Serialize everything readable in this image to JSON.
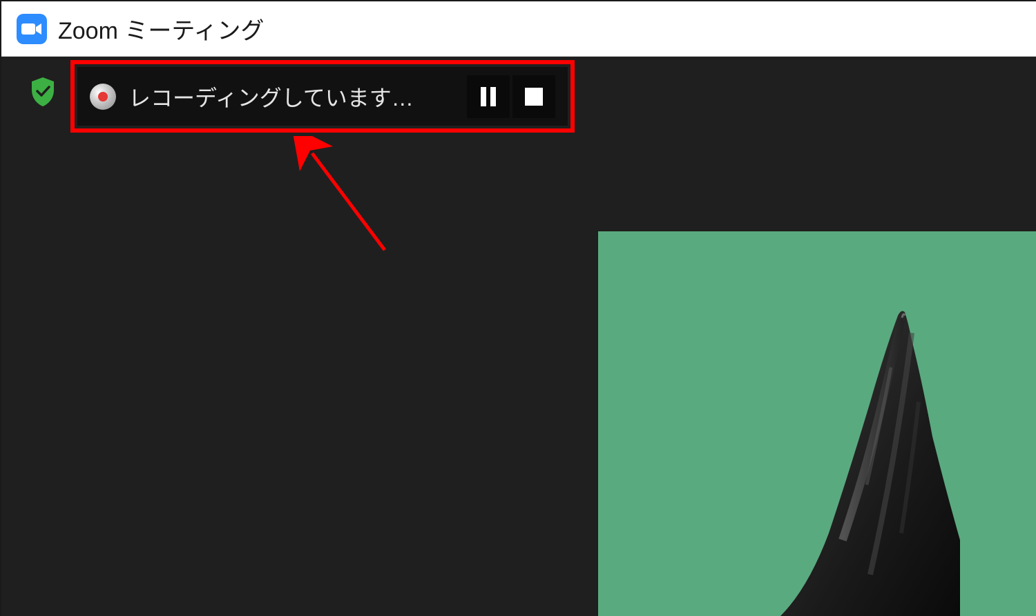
{
  "window": {
    "title": "Zoom ミーティング"
  },
  "recording": {
    "status_text": "レコーディングしています…"
  },
  "colors": {
    "zoom_blue": "#2d8cff",
    "highlight_red": "#ff0000",
    "shield_green": "#3cb043",
    "video_bg": "#5aaa7f"
  }
}
